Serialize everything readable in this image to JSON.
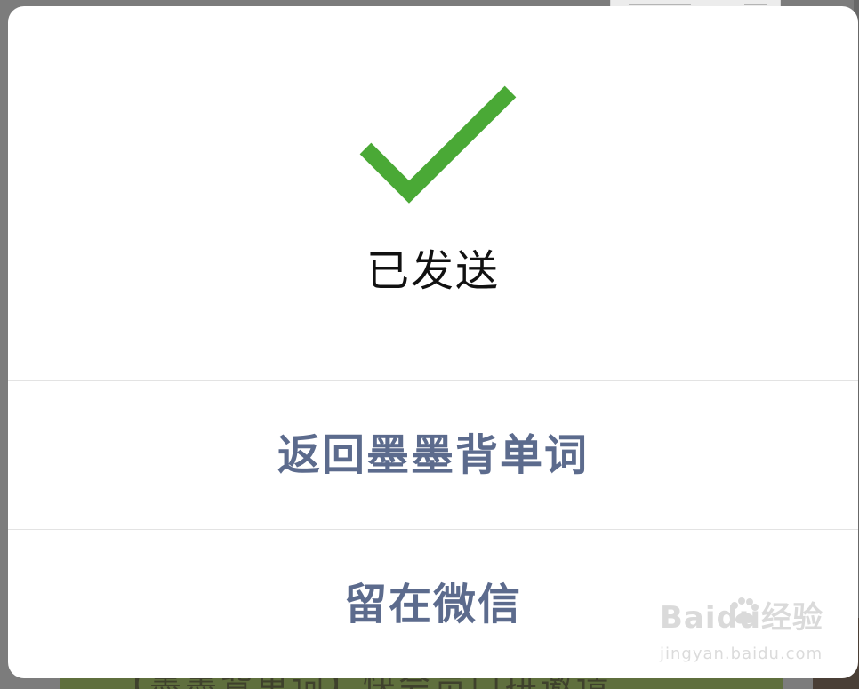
{
  "dialog": {
    "status_text": "已发送",
    "status_icon": "check-icon",
    "primary_action_label": "返回墨墨背单词",
    "secondary_action_label": "留在微信"
  },
  "background": {
    "partial_text": "【墨墨背单词】快会员口拼邀请"
  },
  "watermark": {
    "brand": "Baidu经验",
    "url": "jingyan.baidu.com"
  },
  "colors": {
    "success_green": "#4aa936",
    "action_blue_gray": "#5c6b8d",
    "dialog_background": "#ffffff",
    "divider": "#e3e3e3",
    "overlay": "#7c7c7c"
  }
}
